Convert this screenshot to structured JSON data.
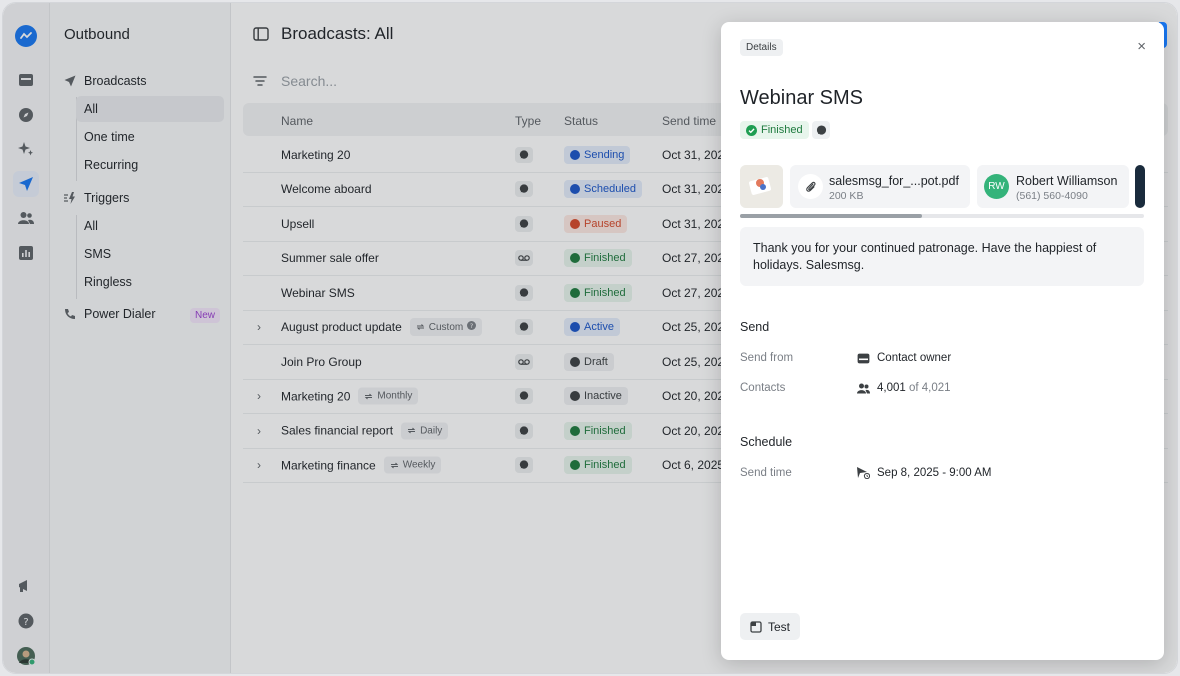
{
  "sidebar": {
    "title": "Outbound",
    "broadcasts_label": "Broadcasts",
    "broadcast_items": [
      "All",
      "One time",
      "Recurring"
    ],
    "triggers_label": "Triggers",
    "trigger_items": [
      "All",
      "SMS",
      "Ringless"
    ],
    "power_dialer_label": "Power Dialer",
    "new_badge": "New"
  },
  "header": {
    "title": "Broadcasts: All"
  },
  "search": {
    "placeholder": "Search..."
  },
  "table": {
    "columns": [
      "Name",
      "Type",
      "Status",
      "Send time"
    ],
    "rows": [
      {
        "name": "Marketing 20",
        "status": "Sending",
        "send": "Oct 31, 202"
      },
      {
        "name": "Welcome aboard",
        "status": "Scheduled",
        "send": "Oct 31, 202"
      },
      {
        "name": "Upsell",
        "status": "Paused",
        "send": "Oct 31, 202"
      },
      {
        "name": "Summer sale offer",
        "status": "Finished",
        "send": "Oct 27, 202"
      },
      {
        "name": "Webinar SMS",
        "status": "Finished",
        "send": "Oct 27, 202"
      },
      {
        "name": "August product update",
        "freq": "Custom",
        "status": "Active",
        "send": "Oct 25, 202"
      },
      {
        "name": "Join Pro Group",
        "status": "Draft",
        "send": "Oct 25, 202"
      },
      {
        "name": "Marketing 20",
        "freq": "Monthly",
        "status": "Inactive",
        "send": "Oct 20, 202"
      },
      {
        "name": "Sales financial report",
        "freq": "Daily",
        "status": "Finished",
        "send": "Oct 20, 202"
      },
      {
        "name": "Marketing finance",
        "freq": "Weekly",
        "status": "Finished",
        "send": "Oct 6, 2025"
      }
    ]
  },
  "drawer": {
    "tag": "Details",
    "close_label": "×",
    "title": "Webinar SMS",
    "status": "Finished",
    "file_name": "salesmsg_for_...pot.pdf",
    "file_size": "200 KB",
    "contact_initials": "RW",
    "contact_name": "Robert Williamson",
    "contact_phone": "(561) 560-4090",
    "progress": 0.45,
    "message": "Thank you for your continued patronage. Have the happiest of holidays. Salesmsg.",
    "send_section": "Send",
    "send_from_label": "Send from",
    "send_from_value": "Contact owner",
    "contacts_label": "Contacts",
    "contacts_value": "4,001",
    "contacts_total": "of 4,021",
    "schedule_section": "Schedule",
    "send_time_label": "Send time",
    "send_time_value": "Sep 8, 2025 - 9:00 AM",
    "test_label": "Test"
  },
  "colors": {
    "accent": "#1877f2",
    "sending": "#1a55c9",
    "scheduled": "#1a55c9",
    "paused": "#d6492a",
    "finished": "#1e7a3e",
    "active": "#1a55c9",
    "draft": "#5f6368",
    "inactive": "#5f6368"
  }
}
